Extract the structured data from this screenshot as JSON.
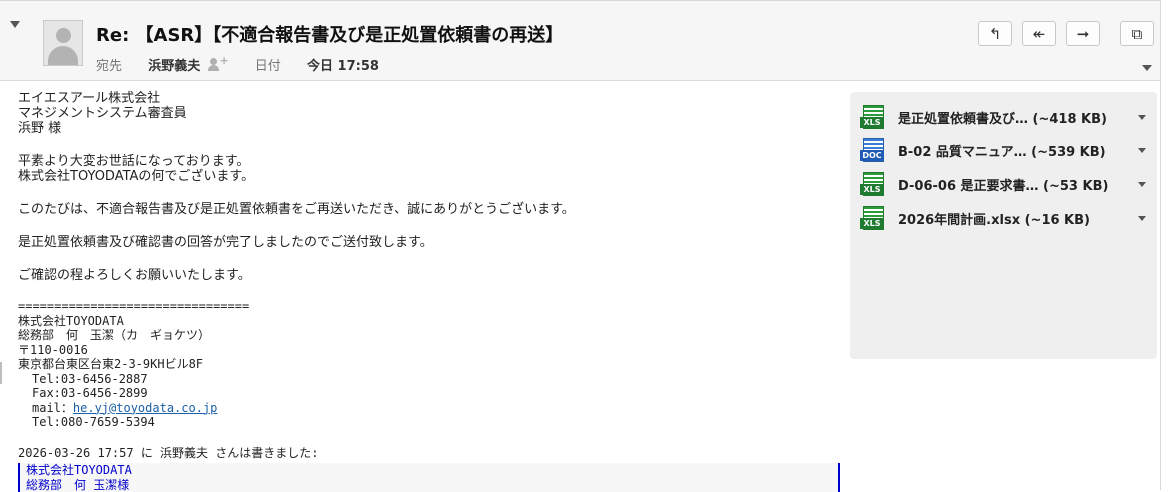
{
  "header": {
    "subject": "Re: 【ASR】【不適合報告書及び是正処置依頼書の再送】",
    "to_label": "宛先",
    "to_value": "浜野義夫",
    "date_label": "日付",
    "date_value": "今日 17:58",
    "buttons": [
      {
        "name": "reply-button",
        "icon": "reply-icon",
        "glyph": "↰"
      },
      {
        "name": "reply-all-button",
        "icon": "reply-all-icon",
        "glyph": "↞"
      },
      {
        "name": "forward-button",
        "icon": "forward-icon",
        "glyph": "➞"
      },
      {
        "name": "open-window-button",
        "icon": "popout-icon",
        "glyph": "⧉"
      }
    ]
  },
  "body": {
    "greeting": [
      "エイエスアール株式会社",
      "マネジメントシステム審査員",
      "浜野 様"
    ],
    "intro": [
      "平素より大変お世話になっております。",
      "株式会社TOYODATAの何でございます。"
    ],
    "p1": "このたびは、不適合報告書及び是正処置依頼書をご再送いただき、誠にありがとうございます。",
    "p2": "是正処置依頼書及び確認書の回答が完了しましたのでご送付致します。",
    "p3": "ご確認の程よろしくお願いいたします。",
    "sig_rule": "================================",
    "sig_company": "株式会社TOYODATA",
    "sig_name": "総務部　何　玉潔（カ　ギョケツ）",
    "sig_zip": "〒110-0016",
    "sig_address": "東京都台東区台東2-3-9KHビル8F",
    "sig_tel": "Tel:03-6456-2887",
    "sig_fax": "Fax:03-6456-2899",
    "sig_mail_label": "mail：",
    "sig_mail": "he.yj@toyodata.co.jp",
    "sig_tel2": "Tel:080-7659-5394",
    "quote_header": "2026-03-26 17:57 に 浜野義夫 さんは書きました:",
    "quote_lines": [
      "株式会社TOYODATA",
      "総務部　何 玉潔様"
    ]
  },
  "attachments": [
    {
      "type": "XLS",
      "icon": "xls-file-icon",
      "label": "是正処置依頼書及び… (~418 KB)"
    },
    {
      "type": "DOC",
      "icon": "doc-file-icon",
      "label": "B-02 品質マニュア… (~539 KB)"
    },
    {
      "type": "XLS",
      "icon": "xls-file-icon",
      "label": "D-06-06 是正要求書… (~53 KB)"
    },
    {
      "type": "XLS",
      "icon": "xls-file-icon",
      "label": "2026年間計画.xlsx (~16 KB)"
    }
  ]
}
